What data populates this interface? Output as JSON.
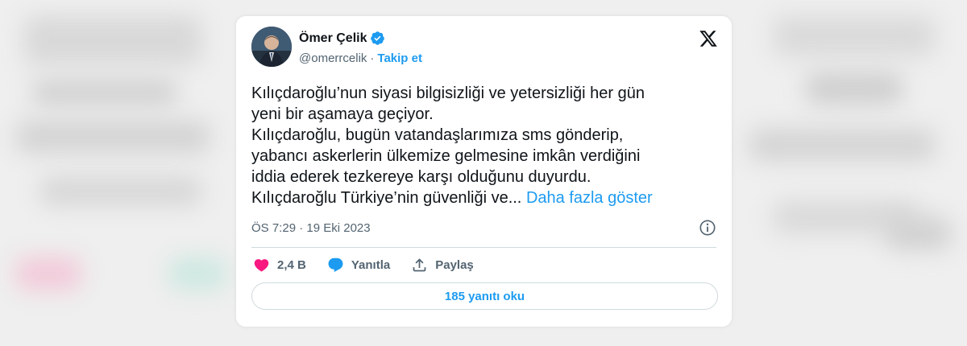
{
  "tweet": {
    "author_name": "Ömer Çelik",
    "author_handle": "@omerrcelik",
    "handle_separator": "·",
    "follow_label": "Takip et",
    "text_lines": [
      "Kılıçdaroğlu’nun siyasi bilgisizliği ve yetersizliği her gün",
      "yeni bir aşamaya geçiyor.",
      "Kılıçdaroğlu, bugün vatandaşlarımıza sms gönderip,",
      "yabancı askerlerin ülkemize gelmesine imkân verdiğini",
      "iddia ederek tezkereye karşı olduğunu duyurdu.",
      "Kılıçdaroğlu Türkiye’nin güvenliği ve..."
    ],
    "show_more_label": "Daha fazla göster",
    "timestamp": "ÖS 7:29 · 19 Eki 2023",
    "likes_count": "2,4 B",
    "reply_label": "Yanıtla",
    "share_label": "Paylaş",
    "read_replies_label": "185 yanıtı oku"
  },
  "icons": {
    "verified": "verified-badge-icon",
    "x_logo": "x-logo-icon",
    "info": "info-icon",
    "like": "heart-icon",
    "reply": "speech-bubble-icon",
    "share": "share-icon"
  },
  "colors": {
    "accent": "#1d9bf0",
    "like": "#f91880",
    "text": "#0f1419",
    "muted": "#536471",
    "border": "#cfd9de"
  }
}
